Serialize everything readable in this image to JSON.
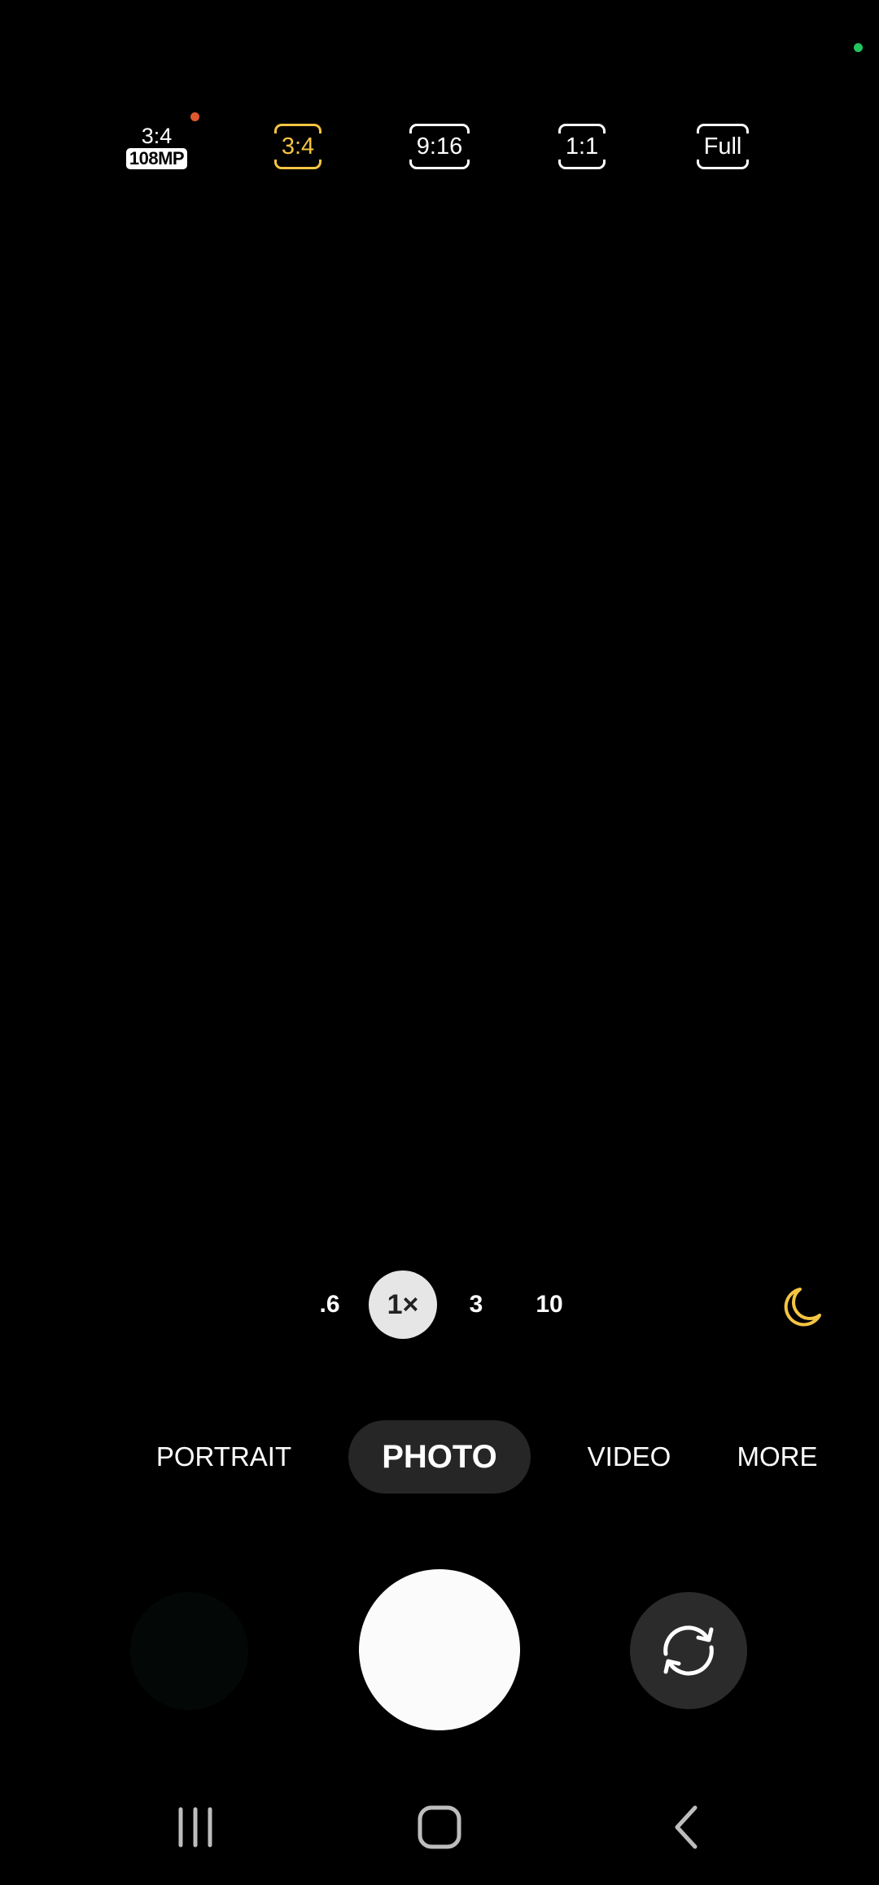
{
  "aspect_ratios": [
    {
      "top": "3:4",
      "badge": "108MP",
      "selected": false,
      "new_indicator": true
    },
    {
      "label": "3:4",
      "selected": true
    },
    {
      "label": "9:16",
      "selected": false
    },
    {
      "label": "1:1",
      "selected": false
    },
    {
      "label": "Full",
      "selected": false
    }
  ],
  "zoom": {
    "levels": [
      ".6",
      "1×",
      "3",
      "10"
    ],
    "selected": "1×"
  },
  "modes": {
    "items": [
      "PORTRAIT",
      "PHOTO",
      "VIDEO",
      "MORE"
    ],
    "selected": "PHOTO"
  },
  "icons": {
    "night": "moon-icon",
    "switch": "switch-camera-icon",
    "nav": [
      "recent-apps-icon",
      "home-icon",
      "back-icon"
    ]
  },
  "colors": {
    "accent": "#f5c542",
    "privacy_indicator": "#22c55e",
    "new_dot": "#e0582c"
  }
}
